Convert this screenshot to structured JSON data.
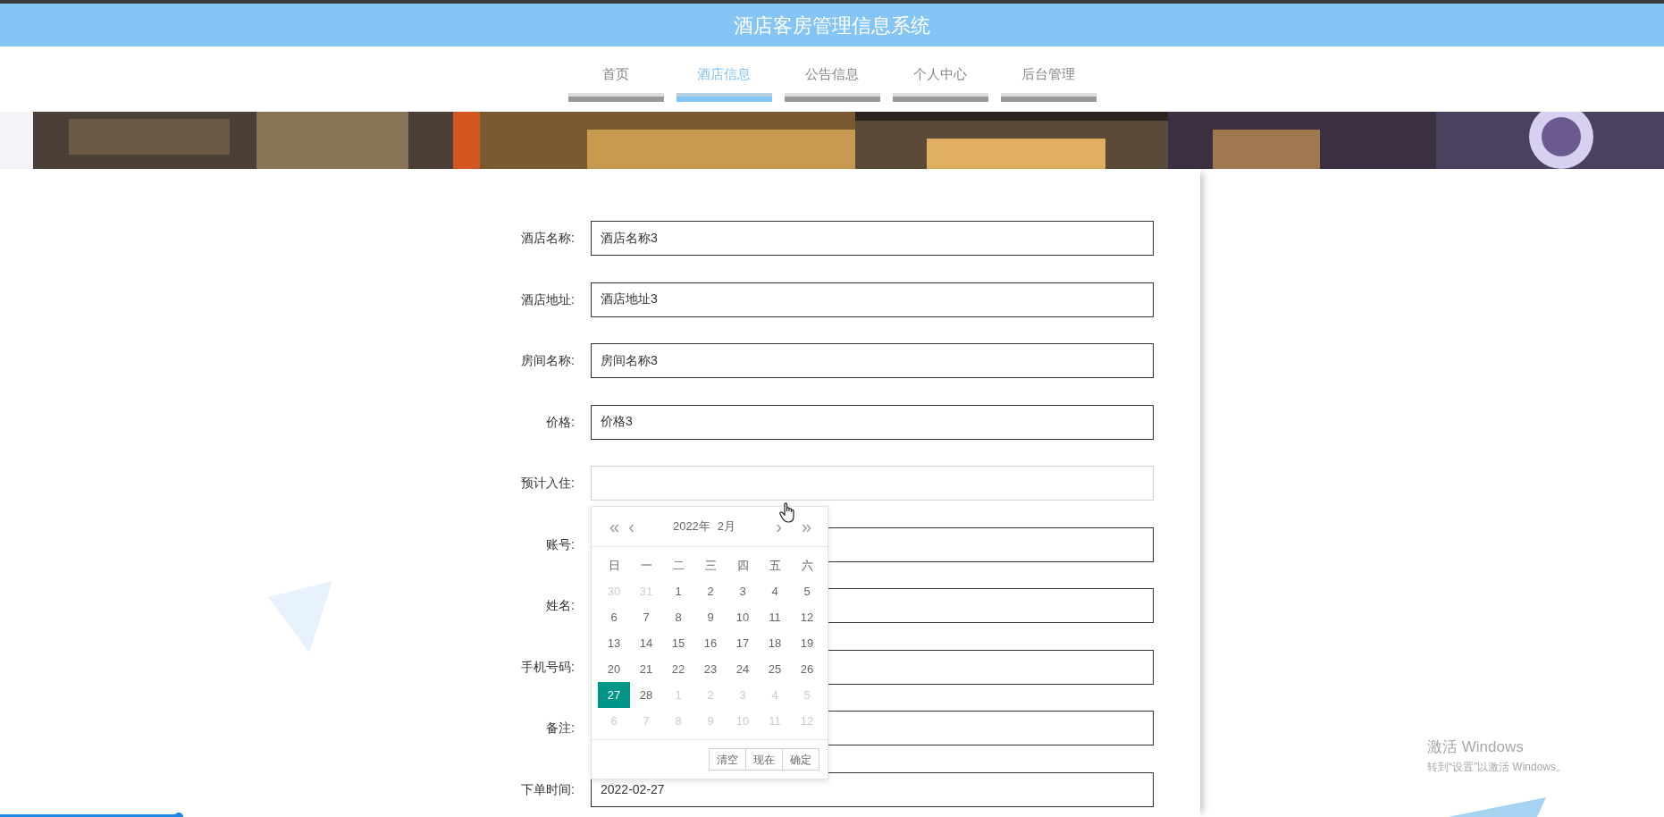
{
  "header": {
    "title": "酒店客房管理信息系统"
  },
  "nav": [
    {
      "label": "首页",
      "selected": false
    },
    {
      "label": "酒店信息",
      "selected": true
    },
    {
      "label": "公告信息",
      "selected": false
    },
    {
      "label": "个人中心",
      "selected": false
    },
    {
      "label": "后台管理",
      "selected": false
    }
  ],
  "form": {
    "fields": [
      {
        "label": "酒店名称:",
        "value": "酒店名称3",
        "focused": false
      },
      {
        "label": "酒店地址:",
        "value": "酒店地址3",
        "focused": false
      },
      {
        "label": "房间名称:",
        "value": "房间名称3",
        "focused": false
      },
      {
        "label": "价格:",
        "value": "价格3",
        "focused": false
      },
      {
        "label": "预计入住:",
        "focused": true
      },
      {
        "label": "账号:",
        "focused": false
      },
      {
        "label": "姓名:",
        "focused": false
      },
      {
        "label": "手机号码:",
        "focused": false
      },
      {
        "label": "备注:",
        "focused": false
      },
      {
        "label": "下单时间:",
        "value": "2022-02-27",
        "focused": false
      }
    ]
  },
  "date_picker": {
    "prev_year": "«",
    "prev_month": "‹",
    "year": "2022年",
    "month": "2月",
    "next_month": "›",
    "next_year": "»",
    "weekdays": [
      "日",
      "一",
      "二",
      "三",
      "四",
      "五",
      "六"
    ],
    "days": [
      {
        "text": "30",
        "other_month": true,
        "selected": false
      },
      {
        "text": "31",
        "other_month": true,
        "selected": false
      },
      {
        "text": "1",
        "other_month": false,
        "selected": false
      },
      {
        "text": "2",
        "other_month": false,
        "selected": false
      },
      {
        "text": "3",
        "other_month": false,
        "selected": false
      },
      {
        "text": "4",
        "other_month": false,
        "selected": false
      },
      {
        "text": "5",
        "other_month": false,
        "selected": false
      },
      {
        "text": "6",
        "other_month": false,
        "selected": false
      },
      {
        "text": "7",
        "other_month": false,
        "selected": false
      },
      {
        "text": "8",
        "other_month": false,
        "selected": false
      },
      {
        "text": "9",
        "other_month": false,
        "selected": false
      },
      {
        "text": "10",
        "other_month": false,
        "selected": false
      },
      {
        "text": "11",
        "other_month": false,
        "selected": false
      },
      {
        "text": "12",
        "other_month": false,
        "selected": false
      },
      {
        "text": "13",
        "other_month": false,
        "selected": false
      },
      {
        "text": "14",
        "other_month": false,
        "selected": false
      },
      {
        "text": "15",
        "other_month": false,
        "selected": false
      },
      {
        "text": "16",
        "other_month": false,
        "selected": false
      },
      {
        "text": "17",
        "other_month": false,
        "selected": false
      },
      {
        "text": "18",
        "other_month": false,
        "selected": false
      },
      {
        "text": "19",
        "other_month": false,
        "selected": false
      },
      {
        "text": "20",
        "other_month": false,
        "selected": false
      },
      {
        "text": "21",
        "other_month": false,
        "selected": false
      },
      {
        "text": "22",
        "other_month": false,
        "selected": false
      },
      {
        "text": "23",
        "other_month": false,
        "selected": false
      },
      {
        "text": "24",
        "other_month": false,
        "selected": false
      },
      {
        "text": "25",
        "other_month": false,
        "selected": false
      },
      {
        "text": "26",
        "other_month": false,
        "selected": false
      },
      {
        "text": "27",
        "other_month": false,
        "selected": true
      },
      {
        "text": "28",
        "other_month": false,
        "selected": false
      },
      {
        "text": "1",
        "other_month": true,
        "selected": false
      },
      {
        "text": "2",
        "other_month": true,
        "selected": false
      },
      {
        "text": "3",
        "other_month": true,
        "selected": false
      },
      {
        "text": "4",
        "other_month": true,
        "selected": false
      },
      {
        "text": "5",
        "other_month": true,
        "selected": false
      },
      {
        "text": "6",
        "other_month": true,
        "selected": false
      },
      {
        "text": "7",
        "other_month": true,
        "selected": false
      },
      {
        "text": "8",
        "other_month": true,
        "selected": false
      },
      {
        "text": "9",
        "other_month": true,
        "selected": false
      },
      {
        "text": "10",
        "other_month": true,
        "selected": false
      },
      {
        "text": "11",
        "other_month": true,
        "selected": false
      },
      {
        "text": "12",
        "other_month": true,
        "selected": false
      }
    ],
    "buttons": [
      "清空",
      "现在",
      "确定"
    ]
  },
  "activation_notice": {
    "title": "激活 Windows",
    "subtitle": "转到“设置”以激活 Windows。"
  }
}
